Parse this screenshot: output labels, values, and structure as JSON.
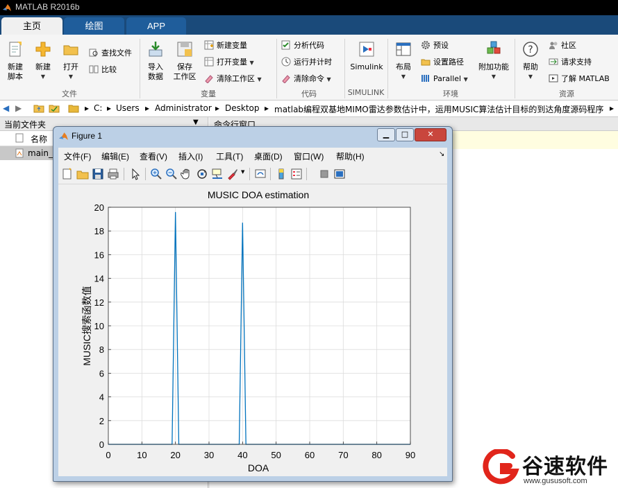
{
  "window": {
    "title": "MATLAB R2016b"
  },
  "tabs": [
    {
      "label": "主页"
    },
    {
      "label": "绘图"
    },
    {
      "label": "APP"
    }
  ],
  "ribbon": {
    "file": {
      "group_label": "文件",
      "new_script": "新建\n脚本",
      "new": "新建",
      "open": "打开",
      "find_files": "查找文件",
      "compare": "比较"
    },
    "variable": {
      "group_label": "变量",
      "import": "导入\n数据",
      "save_workspace": "保存\n工作区",
      "new_variable": "新建变量",
      "open_variable": "打开变量",
      "clear_workspace": "清除工作区"
    },
    "code": {
      "group_label": "代码",
      "analyze": "分析代码",
      "run_and_time": "运行并计时",
      "clear_commands": "清除命令"
    },
    "simulink": {
      "group_label": "SIMULINK",
      "simulink": "Simulink"
    },
    "environment": {
      "group_label": "环境",
      "layout": "布局",
      "preferences": "预设",
      "set_path": "设置路径",
      "parallel": "Parallel",
      "addons": "附加功能"
    },
    "resources": {
      "group_label": "资源",
      "help": "帮助",
      "community": "社区",
      "request_support": "请求支持",
      "learn_matlab": "了解 MATLAB"
    }
  },
  "address": {
    "crumbs": [
      "C:",
      "Users",
      "Administrator",
      "Desktop",
      "matlab编程双基地MIMO雷达参数估计中，运用MUSIC算法估计目标的到达角度源码程序"
    ]
  },
  "current_folder": {
    "title": "当前文件夹",
    "name_col": "名称",
    "files": [
      "main_"
    ]
  },
  "command_window": {
    "title": "命令行窗口"
  },
  "figure": {
    "title": "Figure 1",
    "menus": [
      "文件(F)",
      "编辑(E)",
      "查看(V)",
      "插入(I)",
      "工具(T)",
      "桌面(D)",
      "窗口(W)",
      "帮助(H)"
    ]
  },
  "chart_data": {
    "type": "line",
    "title": "MUSIC DOA estimation",
    "xlabel": "DOA",
    "ylabel": "MUSIC搜索函数值",
    "xlim": [
      0,
      90
    ],
    "ylim": [
      0,
      20
    ],
    "xticks": [
      0,
      10,
      20,
      30,
      40,
      50,
      60,
      70,
      80,
      90
    ],
    "yticks": [
      0,
      2,
      4,
      6,
      8,
      10,
      12,
      14,
      16,
      18,
      20
    ],
    "grid": true,
    "line_color": "#0072bd",
    "x": [
      0,
      19,
      20,
      21,
      39,
      40,
      41,
      90
    ],
    "y": [
      0,
      0,
      19.6,
      0,
      0,
      18.7,
      0,
      0
    ]
  },
  "watermark": {
    "text": "谷速软件",
    "url": "www.gususoft.com"
  },
  "colors": {
    "accent": "#1a4a7a",
    "watermark_red": "#e1251b"
  }
}
